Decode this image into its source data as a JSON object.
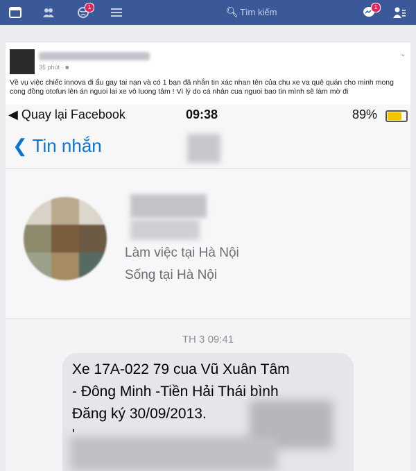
{
  "facebook": {
    "search_placeholder": "Tìm kiếm",
    "notifications_badge": "1",
    "messages_badge": "1"
  },
  "post": {
    "time": "35 phút · ",
    "text": "Về vụ việc chiếc innova đi ẩu gay tai nạn và có 1 bạn đã nhắn tin xác nhan tên của chu xe va quê quán cho minh mong cong đồng otofun lên án nguoi lai xe vô luong tâm ! Vì lý do cá nhân cua nguoi bao tin mình sẽ làm mờ đi"
  },
  "phone": {
    "back_app": "Quay lại Facebook",
    "clock": "09:38",
    "battery": "89%",
    "battery_level": 0.89,
    "nav_title": "Tin nhắn",
    "work": "Làm việc tại Hà Nội",
    "live": "Sống tại Hà Nội",
    "timestamp": "TH 3 09:41",
    "message_lines": [
      "Xe 17A-022 79 cua Vũ Xuân Tâm",
      "- Đông Minh -Tiền Hải Thái bình",
      "Đăng ký 30/09/2013.",
      "'"
    ]
  }
}
